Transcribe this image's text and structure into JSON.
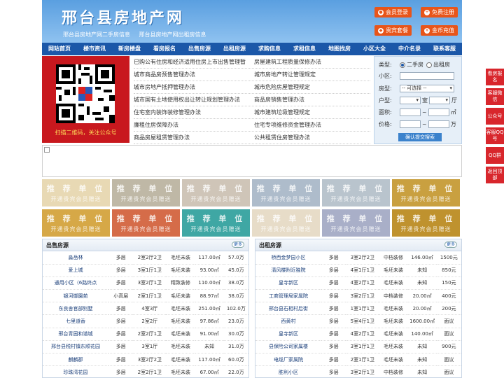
{
  "header": {
    "title": "邢台县房地产网",
    "sub": [
      "邢台县房地产网二手房信息",
      "邢台县房地产网出租房信息"
    ],
    "buttons": [
      "会员登录",
      "免费注册",
      "贵宾套餐",
      "金币充值"
    ]
  },
  "nav": [
    "网站首页",
    "楼市资讯",
    "新房楼盘",
    "看房报名",
    "出售房源",
    "出租房源",
    "求购信息",
    "求租信息",
    "地图找房",
    "小区大全",
    "中介名录",
    "联系客服"
  ],
  "qr": {
    "caption": "扫描二维码，关注公众号"
  },
  "news": [
    [
      "已购公有住房和经济适用住房上市出售管理暂",
      "房屋建筑工程质量保修办法"
    ],
    [
      "城市商品房预售管理办法",
      "城市房地产转让管理规定"
    ],
    [
      "城市房地产抵押管理办法",
      "城市危险房屋管理规定"
    ],
    [
      "城市国有土地使用权出让转让规划管理办法",
      "商品房销售管理办法"
    ],
    [
      "住宅室内装饰装修管理办法",
      "城市建筑垃圾管理规定"
    ],
    [
      "廉租住房保障办法",
      "住宅专项维修资金管理办法"
    ],
    [
      "商品房屋租赁管理办法",
      "公共租赁住房管理办法"
    ]
  ],
  "search": {
    "type_label": "类型:",
    "type_options": [
      "二手房",
      "出租房"
    ],
    "community_label": "小区:",
    "house_type_label": "房型:",
    "house_type_value": "-- 可选择 --",
    "layout_label": "户型:",
    "room_unit": "室",
    "hall_unit": "厅",
    "area_label": "面积:",
    "area_unit": "㎡",
    "price_label": "价格:",
    "price_unit": "万",
    "range_sep": "~",
    "submit": "确认提交搜索"
  },
  "ads": {
    "line1": "推 荐 单 位",
    "line2": "开通贵宾会员赠送",
    "colors": [
      "#e8d9b4",
      "#bfb8a6",
      "#cfc5b8",
      "#aebccb",
      "#b9c4cd",
      "#c9a040",
      "#d6a847",
      "#d56c49",
      "#3fa7a4",
      "#e7dcc8",
      "#a9afc8",
      "#bf922e"
    ]
  },
  "sale": {
    "title": "出售房源",
    "more": "更多",
    "rows": [
      [
        "淼岳林",
        "多层",
        "2室2厅2卫",
        "毛坯未装",
        "117.00㎡",
        "57.0万"
      ],
      [
        "爱上城",
        "多层",
        "3室1厅1卫",
        "毛坯未装",
        "93.00㎡",
        "45.0万"
      ],
      [
        "通用小区（6路终点",
        "多层",
        "3室2厅1卫",
        "精致装修",
        "110.00㎡",
        "38.0万"
      ],
      [
        "银河御園苑",
        "小高层",
        "2室1厅1卫",
        "毛坯未装",
        "88.97㎡",
        "38.0万"
      ],
      [
        "东良舍官部别墅",
        "多层",
        "4室3厅",
        "毛坯未装",
        "251.00㎡",
        "102.0万"
      ],
      [
        "七里道香",
        "多层",
        "2室2厅",
        "毛坯未装",
        "97.86㎡",
        "23.0万"
      ],
      [
        "邢台青园和谐城",
        "多层",
        "2室2厅1卫",
        "毛坯未装",
        "91.00㎡",
        "30.0万"
      ],
      [
        "邢台县税村镇东顺花园",
        "多层",
        "3室1厅",
        "毛坯未装",
        "未知",
        "31.0万"
      ],
      [
        "麒麟郡",
        "多层",
        "3室2厅2卫",
        "毛坯未装",
        "117.00㎡",
        "60.0万"
      ],
      [
        "珍珠湾花园",
        "多层",
        "2室2厅1卫",
        "毛坯未装",
        "67.00㎡",
        "22.0万"
      ]
    ]
  },
  "rent": {
    "title": "出租房源",
    "more": "更多",
    "rows": [
      [
        "桥西金梦园小区",
        "多层",
        "3室2厅2卫",
        "中档装修",
        "146.00㎡",
        "1500元"
      ],
      [
        "清风楼附近独院",
        "多层",
        "4室1厅1卫",
        "毛坯未装",
        "未知",
        "850元"
      ],
      [
        "皇寺新区",
        "多层",
        "4室2厅1卫",
        "毛坯未装",
        "未知",
        "150元"
      ],
      [
        "工商管理局家属院",
        "多层",
        "3室2厅1卫",
        "中档装修",
        "20.00㎡",
        "400元"
      ],
      [
        "邢台县石相村后街",
        "多层",
        "1室1厅1卫",
        "毛坯未装",
        "20.00㎡",
        "200元"
      ],
      [
        "西黄村",
        "多层",
        "5室4厅1卫",
        "毛坯未装",
        "1600.00㎡",
        "面议"
      ],
      [
        "皇寺新区",
        "多层",
        "4室2厅1卫",
        "毛坯未装",
        "140.00㎡",
        "面议"
      ],
      [
        "县保险公司家属楼",
        "多层",
        "3室1厅1卫",
        "毛坯未装",
        "未知",
        "900元"
      ],
      [
        "电缆厂家属院",
        "多层",
        "2室1厅1卫",
        "毛坯未装",
        "未知",
        "面议"
      ],
      [
        "胜利小区",
        "多层",
        "3室2厅1卫",
        "中档装修",
        "未知",
        "面议"
      ]
    ]
  },
  "side": [
    "看房报名",
    "客服微信",
    "公众号",
    "客服QQ号",
    "QQ群",
    "返回顶部"
  ]
}
